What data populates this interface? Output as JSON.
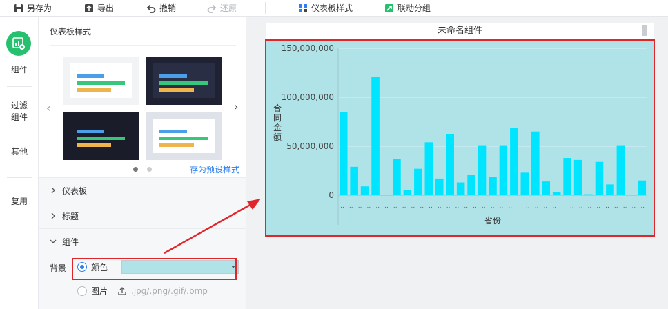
{
  "toolbar": {
    "save_as": "另存为",
    "export": "导出",
    "undo": "撤销",
    "redo": "还原",
    "dashboard_style": "仪表板样式",
    "linkage_group": "联动分组"
  },
  "leftnav": {
    "items": [
      {
        "label": "组件",
        "active": true
      },
      {
        "label": "过滤\n组件",
        "line1": "过滤",
        "line2": "组件"
      },
      {
        "label": "其他"
      },
      {
        "label": "复用"
      }
    ]
  },
  "panel": {
    "title": "仪表板样式",
    "save_preset": "存为预设样式",
    "sections": {
      "dashboard": "仪表板",
      "title": "标题",
      "component": "组件"
    },
    "background": {
      "label": "背景",
      "color_option": "颜色",
      "image_option": "图片",
      "image_formats": ".jpg/.png/.gif/.bmp",
      "color_value": "#b0e3e8"
    }
  },
  "widget": {
    "title": "未命名组件"
  },
  "chart_data": {
    "type": "bar",
    "title": "",
    "xlabel": "省份",
    "ylabel": "合同金额",
    "ylim": [
      0,
      150000000
    ],
    "yticks": [
      "0",
      "50,000,000",
      "100,000,000",
      "150,000,000"
    ],
    "categories": [
      "..",
      "..",
      "..",
      "..",
      "..",
      "..",
      "..",
      "..",
      "..",
      "..",
      "..",
      "..",
      "..",
      "..",
      "..",
      "..",
      "..",
      "..",
      "..",
      "..",
      "..",
      "..",
      "..",
      "..",
      "..",
      "..",
      "..",
      "..",
      "..",
      "..",
      "..",
      "..",
      "..",
      "..",
      ".."
    ],
    "values": [
      85000000,
      29000000,
      9000000,
      121000000,
      0,
      37000000,
      5000000,
      27000000,
      54000000,
      17000000,
      62000000,
      13000000,
      21000000,
      51000000,
      19000000,
      51000000,
      69000000,
      23000000,
      65000000,
      14000000,
      3000000,
      38000000,
      36000000,
      1000000,
      34000000,
      11000000,
      51000000,
      0,
      15000000
    ],
    "bar_color": "#00e5ff",
    "background": "#b0e3e8",
    "grid": true
  },
  "colors": {
    "accent_green": "#25c16f",
    "link_blue": "#2f80ed",
    "highlight_red": "#e0262b"
  }
}
